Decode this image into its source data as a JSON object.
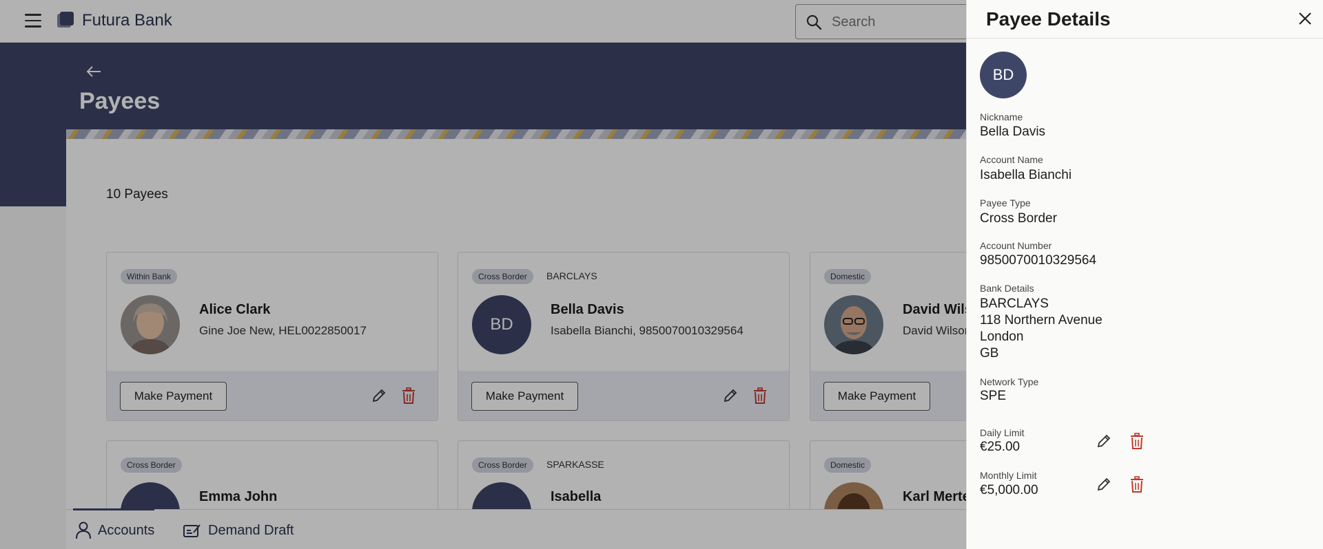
{
  "header": {
    "brand": "Futura Bank",
    "search_placeholder": "Search"
  },
  "page": {
    "title": "Payees",
    "count": "10 Payees"
  },
  "cards": [
    {
      "badge": "Within Bank",
      "bank": "",
      "name": "Alice Clark",
      "sub": "Gine Joe New, HEL0022850017",
      "make_payment": "Make Payment"
    },
    {
      "badge": "Cross Border",
      "bank": "BARCLAYS",
      "initials": "BD",
      "name": "Bella Davis",
      "sub": "Isabella Bianchi, 9850070010329564",
      "make_payment": "Make Payment"
    },
    {
      "badge": "Domestic",
      "bank": "",
      "name": "David Wils",
      "sub": "David Wilson",
      "make_payment": "Make Payment"
    },
    {
      "badge": "Cross Border",
      "bank": "",
      "name": "Emma John"
    },
    {
      "badge": "Cross Border",
      "bank": "SPARKASSE",
      "name": "Isabella"
    },
    {
      "badge": "Domestic",
      "bank": "",
      "name": "Karl Merte"
    }
  ],
  "bottom_nav": {
    "accounts": "Accounts",
    "demand_draft": "Demand Draft"
  },
  "drawer": {
    "title": "Payee Details",
    "initials": "BD",
    "nickname_label": "Nickname",
    "nickname": "Bella Davis",
    "account_name_label": "Account Name",
    "account_name": "Isabella Bianchi",
    "payee_type_label": "Payee Type",
    "payee_type": "Cross Border",
    "account_number_label": "Account Number",
    "account_number": "9850070010329564",
    "bank_details_label": "Bank Details",
    "bank_lines": [
      "BARCLAYS",
      "118 Northern Avenue",
      "London",
      "GB"
    ],
    "network_type_label": "Network Type",
    "network_type": "SPE",
    "daily_limit_label": "Daily Limit",
    "daily_limit": "€25.00",
    "monthly_limit_label": "Monthly Limit",
    "monthly_limit": "€5,000.00"
  },
  "colors": {
    "brand_navy": "#3e4668",
    "delete_red": "#c0392b",
    "card_footer": "#eceef6"
  }
}
